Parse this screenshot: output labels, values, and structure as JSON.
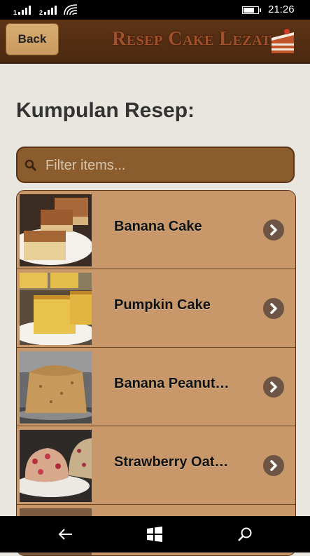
{
  "status_bar": {
    "signal1_label": "1",
    "signal2_label": "2",
    "time": "21:26"
  },
  "header": {
    "back_label": "Back",
    "app_title": "Resep Cake Lezat",
    "logo_icon": "layer-cake-icon"
  },
  "main": {
    "title": "Kumpulan Resep:",
    "filter_placeholder": "Filter items...",
    "items": [
      {
        "label": "Banana Cake",
        "image_icon": "banana-cake-photo"
      },
      {
        "label": "Pumpkin Cake",
        "image_icon": "pumpkin-cake-photo"
      },
      {
        "label": "Banana Peanut…",
        "image_icon": "banana-peanut-cake-photo"
      },
      {
        "label": "Strawberry Oat…",
        "image_icon": "strawberry-oat-cake-photo"
      }
    ]
  },
  "nav_bar": {
    "back_icon": "back-arrow-icon",
    "home_icon": "windows-logo-icon",
    "search_icon": "search-icon"
  },
  "colors": {
    "header_bg": "#5e3416",
    "list_bg": "#c8986a",
    "filter_bg": "#8a5c2e",
    "title_text": "#a0502a"
  }
}
